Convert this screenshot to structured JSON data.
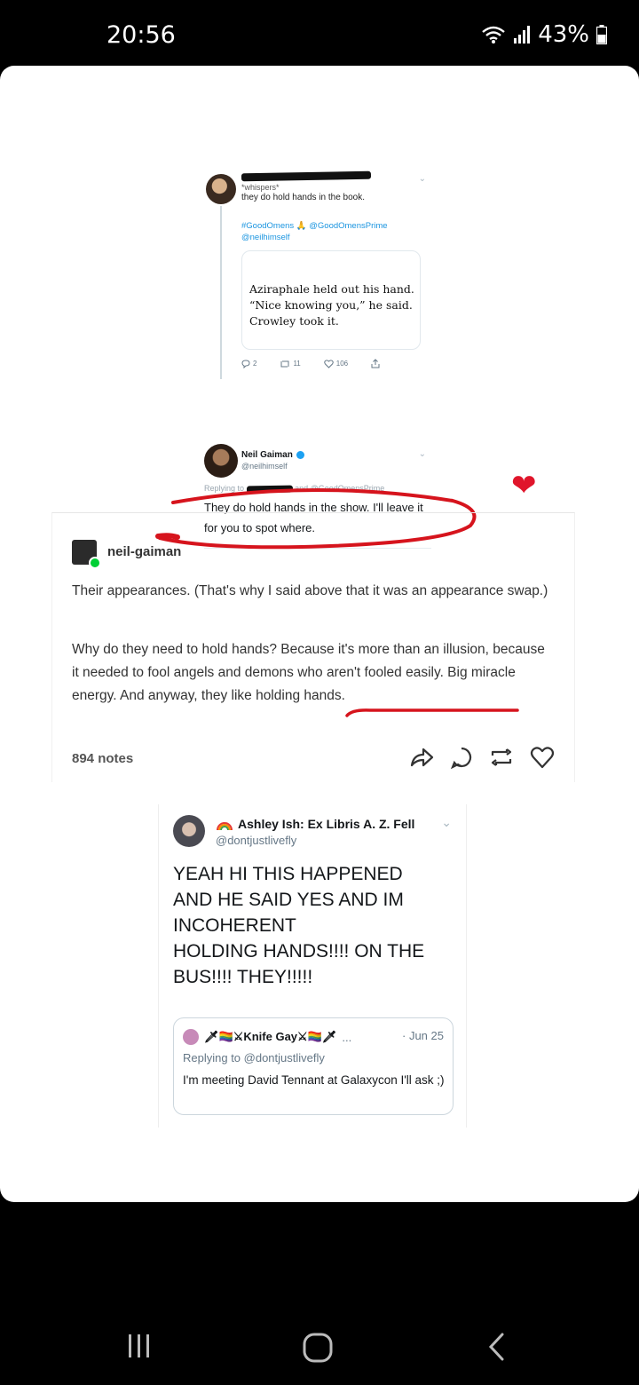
{
  "status": {
    "time": "20:56",
    "battery": "43%"
  },
  "tweet1": {
    "user_line": "*whispers*",
    "body": "they do hold hands in the book.",
    "tags_line1": "#GoodOmens 🙏 @GoodOmensPrime",
    "tags_line2": "@neilhimself",
    "quote_text": "Aziraphale held out his hand. “Nice knowing you,” he said. Crowley took it.",
    "replies": "2",
    "retweets": "11",
    "likes": "106"
  },
  "tweet_neil": {
    "name": "Neil Gaiman",
    "handle": "@neilhimself",
    "replying": "Replying to",
    "replying_tail": "and @GoodOmensPrime",
    "body": "They do hold hands in the show. I'll leave it for you to spot where."
  },
  "tumblr": {
    "username": "neil-gaiman",
    "p1": "Their appearances. (That's why I said above that it was an appearance swap.)",
    "p2": "Why do they need to hold hands? Because it's more than an illusion, because it needed to fool angels and demons who aren't fooled easily. Big miracle energy. And anyway, they like holding hands.",
    "notes": "894 notes"
  },
  "tweet2": {
    "name": "Ashley Ish: Ex Libris A. Z. Fell",
    "handle": "@dontjustlivefly",
    "body_lines": [
      "YEAH HI THIS HAPPENED",
      "AND HE SAID YES AND IM",
      "INCOHERENT",
      "HOLDING HANDS!!!! ON THE",
      "BUS!!!! THEY!!!!!"
    ],
    "quote": {
      "name": "🗡🏳️‍🌈⚔Knife Gay⚔🏳️‍🌈🗡",
      "ellipsis": "...",
      "date": "· Jun 25",
      "reply": "Replying to @dontjustlivefly",
      "body": "I'm meeting David Tennant at Galaxycon I'll ask ;)"
    }
  },
  "colors": {
    "accent_red": "#d6141d",
    "twitter_blue": "#1b95e0",
    "tumblr_green": "#00cf35"
  },
  "icons": [
    "wifi-icon",
    "signal-icon",
    "battery-icon",
    "heart-emoji",
    "share-icon",
    "reply-icon",
    "reblog-icon",
    "like-icon",
    "recents-icon",
    "home-icon",
    "back-icon"
  ]
}
